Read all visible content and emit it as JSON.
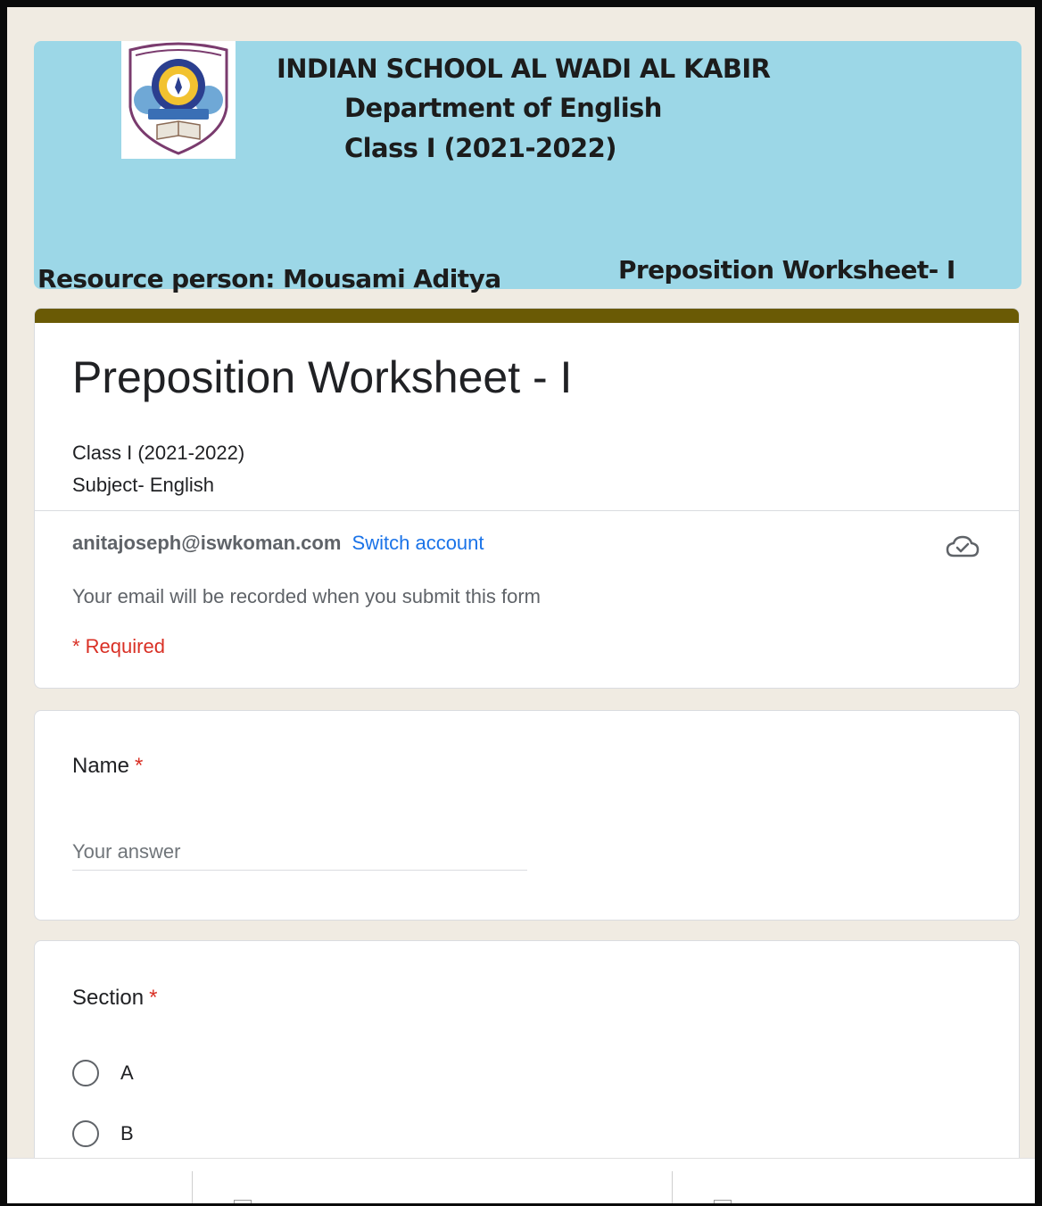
{
  "banner": {
    "school": "INDIAN SCHOOL AL WADI AL KABIR",
    "department": "Department of English",
    "class": "Class I (2021-2022)",
    "resource_person": "Resource person: Mousami Aditya",
    "worksheet": "Preposition Worksheet- I",
    "logo_icon": "school-crest-logo"
  },
  "form": {
    "title": "Preposition Worksheet - I",
    "description_line1": "Class I (2021-2022)",
    "description_line2": "Subject- English",
    "theme_color": "#6a5a05",
    "account_email": "anitajoseph@iswkoman.com",
    "switch_account": "Switch account",
    "cloud_icon": "cloud-check-icon",
    "email_note": "Your email will be recorded when you submit this form",
    "required_note": "* Required"
  },
  "questions": {
    "name": {
      "label": "Name",
      "required_mark": "*",
      "placeholder": "Your answer",
      "value": ""
    },
    "section": {
      "label": "Section",
      "required_mark": "*",
      "options": [
        "A",
        "B"
      ]
    }
  },
  "colors": {
    "banner_bg": "#9cd7e7",
    "page_bg": "#f0ebe2",
    "link": "#1a73e8",
    "required": "#d93025"
  }
}
